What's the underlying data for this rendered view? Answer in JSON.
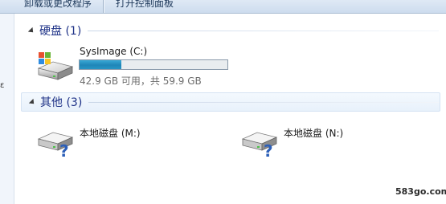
{
  "toolbar": {
    "items": [
      {
        "label": "卸载或更改程序"
      },
      {
        "label": "打开控制面板"
      }
    ]
  },
  "groups": {
    "hard_disks": {
      "title": "硬盘 (1)",
      "drives": [
        {
          "name": "SysImage (C:)",
          "icon": "windows-drive-icon",
          "free_text": "42.9 GB 可用，共 59.9 GB",
          "used_fraction": 0.284,
          "bar_color": "#2794c4"
        }
      ]
    },
    "other": {
      "title": "其他 (3)",
      "drives": [
        {
          "name": "本地磁盘 (M:)",
          "icon": "unknown-drive-icon"
        },
        {
          "name": "本地磁盘 (N:)",
          "icon": "unknown-drive-icon"
        }
      ]
    }
  },
  "watermark": {
    "text": "583go.com"
  },
  "colors": {
    "group_title": "#1e3287",
    "usage_fill": "#2794c4",
    "question_mark": "#2c5fb8"
  }
}
